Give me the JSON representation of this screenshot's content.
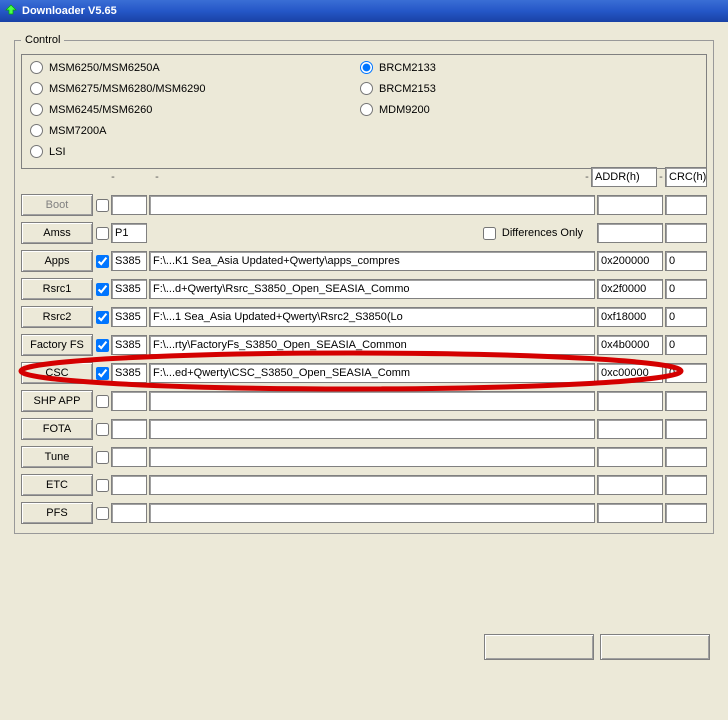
{
  "title": "Downloader V5.65",
  "control_legend": "Control",
  "radios_left": [
    {
      "label": "MSM6250/MSM6250A",
      "checked": false
    },
    {
      "label": "MSM6275/MSM6280/MSM6290",
      "checked": false
    },
    {
      "label": "MSM6245/MSM6260",
      "checked": false
    },
    {
      "label": "MSM7200A",
      "checked": false
    },
    {
      "label": "LSI",
      "checked": false
    }
  ],
  "radios_right": [
    {
      "label": "BRCM2133",
      "checked": true
    },
    {
      "label": "BRCM2153",
      "checked": false
    },
    {
      "label": "MDM9200",
      "checked": false
    }
  ],
  "header": {
    "addr": "ADDR(h)",
    "crc": "CRC(h)"
  },
  "diff_label": "Differences Only",
  "rows": [
    {
      "btn": "Boot",
      "disabled": true,
      "chk": false,
      "code": "",
      "path": "",
      "addr": "",
      "crc": ""
    },
    {
      "btn": "Amss",
      "disabled": false,
      "chk": false,
      "code": "P1",
      "path": "",
      "addr": "",
      "crc": "",
      "show_diff": true
    },
    {
      "btn": "Apps",
      "disabled": false,
      "chk": true,
      "code": "S385",
      "path": "F:\\...K1 Sea_Asia Updated+Qwerty\\apps_compres",
      "addr": "0x200000",
      "crc": "0"
    },
    {
      "btn": "Rsrc1",
      "disabled": false,
      "chk": true,
      "code": "S385",
      "path": "F:\\...d+Qwerty\\Rsrc_S3850_Open_SEASIA_Commo",
      "addr": "0x2f0000",
      "crc": "0"
    },
    {
      "btn": "Rsrc2",
      "disabled": false,
      "chk": true,
      "code": "S385",
      "path": "F:\\...1 Sea_Asia Updated+Qwerty\\Rsrc2_S3850(Lo",
      "addr": "0xf18000",
      "crc": "0"
    },
    {
      "btn": "Factory FS",
      "disabled": false,
      "chk": true,
      "code": "S385",
      "path": "F:\\...rty\\FactoryFs_S3850_Open_SEASIA_Common",
      "addr": "0x4b0000",
      "crc": "0"
    },
    {
      "btn": "CSC",
      "disabled": false,
      "chk": true,
      "code": "S385",
      "path": "F:\\...ed+Qwerty\\CSC_S3850_Open_SEASIA_Comm",
      "addr": "0xc00000",
      "crc": "0",
      "highlight": true
    },
    {
      "btn": "SHP APP",
      "disabled": false,
      "chk": false,
      "code": "",
      "path": "",
      "addr": "",
      "crc": ""
    },
    {
      "btn": "FOTA",
      "disabled": false,
      "chk": false,
      "code": "",
      "path": "",
      "addr": "",
      "crc": ""
    },
    {
      "btn": "Tune",
      "disabled": false,
      "chk": false,
      "code": "",
      "path": "",
      "addr": "",
      "crc": ""
    },
    {
      "btn": "ETC",
      "disabled": false,
      "chk": false,
      "code": "",
      "path": "",
      "addr": "",
      "crc": ""
    },
    {
      "btn": "PFS",
      "disabled": false,
      "chk": false,
      "code": "",
      "path": "",
      "addr": "",
      "crc": ""
    }
  ]
}
